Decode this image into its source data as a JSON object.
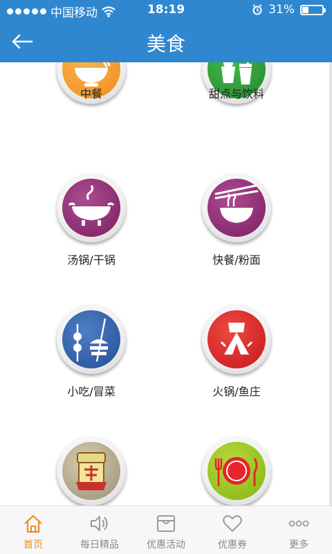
{
  "status_bar": {
    "carrier": "中国移动",
    "time": "18:19",
    "battery": "31%",
    "battery_level": 0.31
  },
  "header": {
    "title": "美食",
    "back_icon": "back-arrow-icon"
  },
  "categories": [
    {
      "label": "中餐",
      "icon": "rice-bowl-icon",
      "color": "#f29a2e"
    },
    {
      "label": "甜点与饮料",
      "icon": "drinks-icon",
      "color": "#2f9e3a"
    },
    {
      "label": "汤锅/干锅",
      "icon": "hotpot-icon",
      "color": "#8e2f73"
    },
    {
      "label": "快餐/粉面",
      "icon": "noodle-bowl-icon",
      "color": "#8e2f73"
    },
    {
      "label": "小吃/冒菜",
      "icon": "skewers-icon",
      "color": "#2f5fa8"
    },
    {
      "label": "火锅/鱼庄",
      "icon": "hotpot-fish-icon",
      "color": "#d6262a"
    },
    {
      "label": "",
      "icon": "wine-sign-icon",
      "color": "#b8ac8f"
    },
    {
      "label": "",
      "icon": "plate-cutlery-icon",
      "color": "#9bc41e"
    }
  ],
  "tabbar": {
    "items": [
      {
        "label": "首页",
        "icon": "home-icon",
        "active": true
      },
      {
        "label": "每日精品",
        "icon": "speaker-icon",
        "active": false
      },
      {
        "label": "优惠活动",
        "icon": "shop-icon",
        "active": false
      },
      {
        "label": "优惠券",
        "icon": "heart-icon",
        "active": false
      },
      {
        "label": "更多",
        "icon": "more-icon",
        "active": false
      }
    ],
    "active_color": "#f08c1e",
    "inactive_color": "#8a8a8a"
  }
}
